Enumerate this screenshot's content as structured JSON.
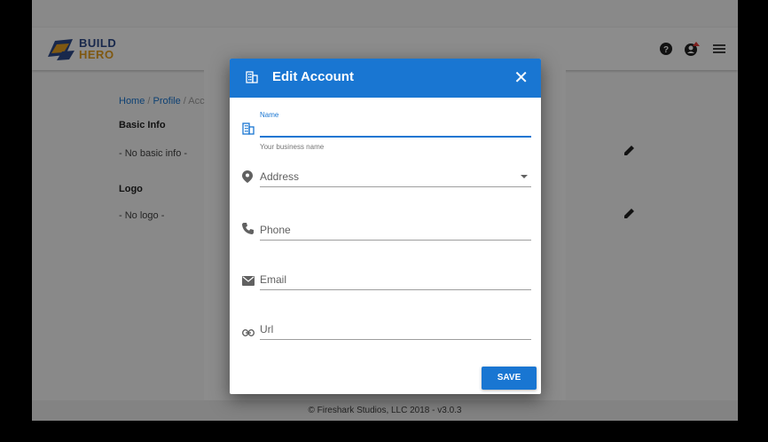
{
  "header": {
    "logo": {
      "line1": "BUILD",
      "line2": "HERO"
    },
    "icons": [
      "help-icon",
      "account-icon",
      "menu-icon"
    ]
  },
  "breadcrumb": {
    "home": "Home",
    "sep1": "/",
    "profile": "Profile",
    "sep2": "/",
    "current": "Acc"
  },
  "sections": {
    "basic_info_title": "Basic Info",
    "basic_info_value": "- No basic info -",
    "logo_title": "Logo",
    "logo_value": "- No logo -"
  },
  "footer": {
    "text": "© Fireshark Studios, LLC 2018 - v3.0.3"
  },
  "dialog": {
    "title": "Edit Account",
    "close": "✕",
    "name_label": "Name",
    "name_helper": "Your business name",
    "address_placeholder": "Address",
    "phone_placeholder": "Phone",
    "email_placeholder": "Email",
    "url_placeholder": "Url",
    "save_label": "SAVE"
  },
  "colors": {
    "primary": "#1976d2",
    "accent": "#e8a020"
  }
}
